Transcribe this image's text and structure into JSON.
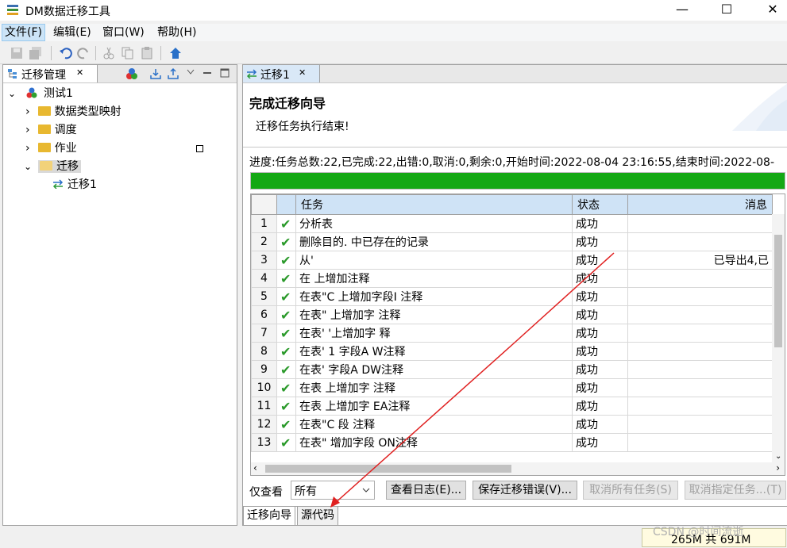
{
  "window": {
    "title": "DM数据迁移工具",
    "controls": {
      "minimize": "—",
      "maximize": "☐",
      "close": "✕"
    }
  },
  "menubar": {
    "items": [
      "文件(F)",
      "编辑(E)",
      "窗口(W)",
      "帮助(H)"
    ]
  },
  "toolbar": {
    "icons": [
      "save-icon",
      "save-all-icon",
      "undo-icon",
      "redo-icon",
      "cut-icon",
      "copy-icon",
      "paste-icon",
      "home-icon"
    ]
  },
  "left_panel": {
    "tab_label": "迁移管理",
    "close_glyph": "✕",
    "tree": {
      "root": "测试1",
      "children": [
        {
          "label": "数据类型映射",
          "expander": "›"
        },
        {
          "label": "调度",
          "expander": "›"
        },
        {
          "label": "作业",
          "expander": "›"
        },
        {
          "label": "迁移",
          "expander": "⌄",
          "children": [
            "迁移1"
          ]
        }
      ]
    }
  },
  "right_panel": {
    "tab_label": "迁移1",
    "close_glyph": "✕",
    "wizard_title": "完成迁移向导",
    "wizard_message": "迁移任务执行结束!",
    "progress_text": "进度:任务总数:22,已完成:22,出错:0,取消:0,剩余:0,开始时间:2022-08-04 23:16:55,结束时间:2022-08-",
    "progress_value": 1.0,
    "table": {
      "columns": [
        "",
        "",
        "任务",
        "状态",
        "消息"
      ],
      "rows": [
        {
          "n": "1",
          "task": "分析表",
          "status": "成功",
          "msg": ""
        },
        {
          "n": "2",
          "task": "删除目的.   中已存在的记录",
          "status": "成功",
          "msg": ""
        },
        {
          "n": "3",
          "task": "从'",
          "status": "成功",
          "msg": "已导出4,已"
        },
        {
          "n": "4",
          "task": "在    上增加注释",
          "status": "成功",
          "msg": ""
        },
        {
          "n": "5",
          "task": "在表\"C    上增加字段I 注释",
          "status": "成功",
          "msg": ""
        },
        {
          "n": "6",
          "task": "在表\"    上增加字    注释",
          "status": "成功",
          "msg": ""
        },
        {
          "n": "7",
          "task": "在表'    '上增加字    释",
          "status": "成功",
          "msg": ""
        },
        {
          "n": "8",
          "task": "在表'    1 字段A    W注释",
          "status": "成功",
          "msg": ""
        },
        {
          "n": "9",
          "task": "在表'    字段A    DW注释",
          "status": "成功",
          "msg": ""
        },
        {
          "n": "10",
          "task": "在表    上增加字    注释",
          "status": "成功",
          "msg": ""
        },
        {
          "n": "11",
          "task": "在表    上增加字    EA注释",
          "status": "成功",
          "msg": ""
        },
        {
          "n": "12",
          "task": "在表\"C    段    注释",
          "status": "成功",
          "msg": ""
        },
        {
          "n": "13",
          "task": "在表\"    增加字段    ON注释",
          "status": "成功",
          "msg": ""
        }
      ]
    },
    "filter_label": "仅查看",
    "filter_value": "所有",
    "buttons": {
      "view_log": "查看日志(E)...",
      "save_errors": "保存迁移错误(V)...",
      "cancel_all": "取消所有任务(S)",
      "cancel_selected": "取消指定任务...(T)"
    },
    "bottom_tabs": [
      "迁移向导",
      "源代码"
    ]
  },
  "status_bar": {
    "memory": "265M 共 691M",
    "watermark": "CSDN @时间流逝"
  },
  "colors": {
    "progress": "#14a814",
    "header_bg": "#cfe3f6",
    "check": "#2b9a2b",
    "annotation_arrow": "#e02020"
  }
}
